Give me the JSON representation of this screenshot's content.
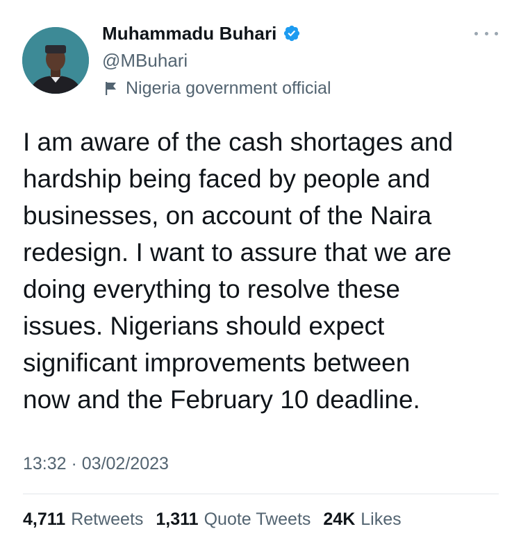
{
  "author": {
    "display_name": "Muhammadu Buhari",
    "handle": "@MBuhari",
    "verified_icon": "verified-badge-icon",
    "verified_color": "#1d9bf0",
    "affiliation_label": "Nigeria government official",
    "affiliation_icon": "flag-icon"
  },
  "menu": {
    "icon": "more-options-icon"
  },
  "tweet": {
    "text": "I am aware of the cash shortages and\nhardship being faced by people and\nbusinesses, on account of the Naira\nredesign. I want to assure that we are\ndoing everything to resolve these\nissues. Nigerians should expect\nsignificant improvements between\nnow and the February 10 deadline.",
    "timestamp": "13:32 · 03/02/2023"
  },
  "stats": {
    "retweets_count": "4,711",
    "retweets_label": "Retweets",
    "quotes_count": "1,311",
    "quotes_label": "Quote Tweets",
    "likes_count": "24K",
    "likes_label": "Likes"
  },
  "colors": {
    "text_primary": "#0f1419",
    "text_secondary": "#536471",
    "divider": "#e1e6ea",
    "avatar_background": "#3d8a96"
  }
}
